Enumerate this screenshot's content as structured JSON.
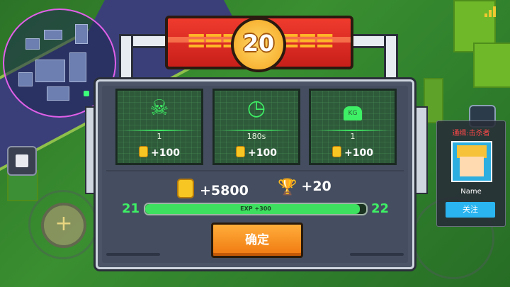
{
  "level_up": {
    "new_level": "20",
    "stats": [
      {
        "icon": "skull-crossbones-icon",
        "value": "1",
        "reward": "+100"
      },
      {
        "icon": "stopwatch-icon",
        "value": "180s",
        "reward": "+100"
      },
      {
        "icon": "kg-weight-icon",
        "icon_text": "KG",
        "value": "1",
        "reward": "+100"
      }
    ],
    "total_coins": "+5800",
    "total_trophies": "+20",
    "current_level": "21",
    "next_level": "22",
    "exp_label": "EXP +300",
    "exp_progress": 0.97,
    "confirm_label": "确定"
  },
  "bounty": {
    "title": "通缉:击杀者",
    "player_name": "Name",
    "follow_label": "关注"
  },
  "colors": {
    "accent_green": "#3ef065",
    "banner_red": "#e02c24",
    "coin_gold": "#f7c623",
    "confirm_orange": "#f58c1e",
    "bounty_red": "#ff4848",
    "follow_blue": "#2ab4f0",
    "minimap_ring": "#e060e8"
  }
}
